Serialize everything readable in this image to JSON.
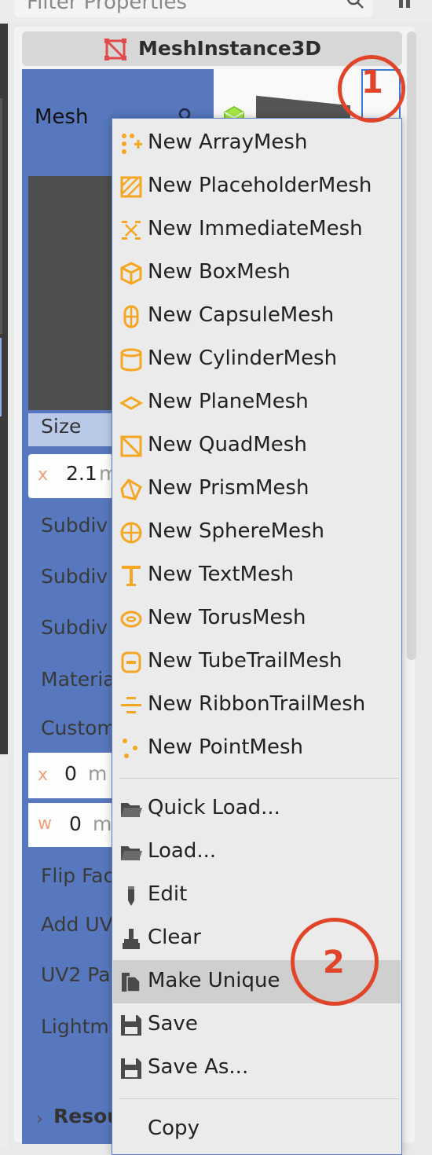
{
  "filter": {
    "placeholder": "Filter Properties"
  },
  "inspector": {
    "node_title": "MeshInstance3D",
    "mesh_label": "Mesh",
    "size_label": "Size",
    "size_x_axis": "x",
    "size_x_value": "2.1",
    "size_x_unit": "m",
    "truncated_labels": [
      "Subdiv",
      "Subdiv",
      "Subdiv",
      "Materia",
      "Custom",
      "Flip Fac",
      "Add UV",
      "UV2 Pa",
      "Lightm"
    ],
    "custom_x_axis": "x",
    "custom_x_value": "0",
    "custom_x_unit": "m",
    "custom_w_axis": "w",
    "custom_w_value": "0",
    "custom_w_unit": "m",
    "resource_label": "Resou"
  },
  "menu": {
    "new_items": [
      {
        "label": "New ArrayMesh",
        "icon": "array-mesh-icon"
      },
      {
        "label": "New PlaceholderMesh",
        "icon": "placeholder-mesh-icon"
      },
      {
        "label": "New ImmediateMesh",
        "icon": "immediate-mesh-icon"
      },
      {
        "label": "New BoxMesh",
        "icon": "box-mesh-icon"
      },
      {
        "label": "New CapsuleMesh",
        "icon": "capsule-mesh-icon"
      },
      {
        "label": "New CylinderMesh",
        "icon": "cylinder-mesh-icon"
      },
      {
        "label": "New PlaneMesh",
        "icon": "plane-mesh-icon"
      },
      {
        "label": "New QuadMesh",
        "icon": "quad-mesh-icon"
      },
      {
        "label": "New PrismMesh",
        "icon": "prism-mesh-icon"
      },
      {
        "label": "New SphereMesh",
        "icon": "sphere-mesh-icon"
      },
      {
        "label": "New TextMesh",
        "icon": "text-mesh-icon"
      },
      {
        "label": "New TorusMesh",
        "icon": "torus-mesh-icon"
      },
      {
        "label": "New TubeTrailMesh",
        "icon": "tube-trail-mesh-icon"
      },
      {
        "label": "New RibbonTrailMesh",
        "icon": "ribbon-trail-mesh-icon"
      },
      {
        "label": "New PointMesh",
        "icon": "point-mesh-icon"
      }
    ],
    "actions": [
      {
        "label": "Quick Load...",
        "icon": "folder-icon"
      },
      {
        "label": "Load...",
        "icon": "folder-icon"
      },
      {
        "label": "Edit",
        "icon": "edit-icon"
      },
      {
        "label": "Clear",
        "icon": "clear-icon"
      },
      {
        "label": "Make Unique",
        "icon": "duplicate-icon",
        "highlighted": true
      },
      {
        "label": "Save",
        "icon": "save-icon"
      },
      {
        "label": "Save As...",
        "icon": "save-icon"
      }
    ],
    "extra": [
      {
        "label": "Copy"
      }
    ]
  },
  "callouts": {
    "first": "1",
    "second": "2"
  },
  "colors": {
    "accent_icon": "#f5a623",
    "callout": "#e0452a",
    "selection_blue": "#5778be"
  }
}
